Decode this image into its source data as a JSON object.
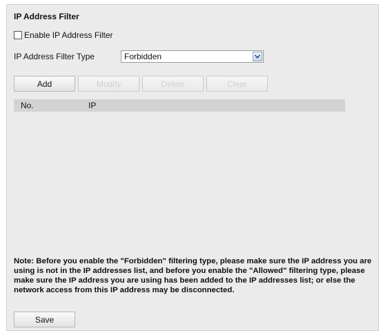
{
  "section": {
    "title": "IP Address Filter"
  },
  "enable": {
    "label": "Enable IP Address Filter",
    "checked": false
  },
  "filter_type": {
    "label": "IP Address Filter Type",
    "value": "Forbidden"
  },
  "buttons": {
    "add": "Add",
    "modify": "Modify",
    "delete": "Delete",
    "clear": "Clear"
  },
  "table": {
    "columns": [
      "No.",
      "IP"
    ],
    "rows": []
  },
  "note": "Note: Before you enable the \"Forbidden\" filtering type, please make sure the IP address you are using is not in the IP addresses list, and before you enable the \"Allowed\" filtering type, please make sure the IP address you are using has been added to the IP addresses list; or else the network access from this IP address may be disconnected.",
  "save": {
    "label": "Save"
  },
  "colors": {
    "panel_bg": "#ebebeb",
    "header_bg": "#d3d3d3",
    "disabled_text": "#cfcfcf"
  }
}
